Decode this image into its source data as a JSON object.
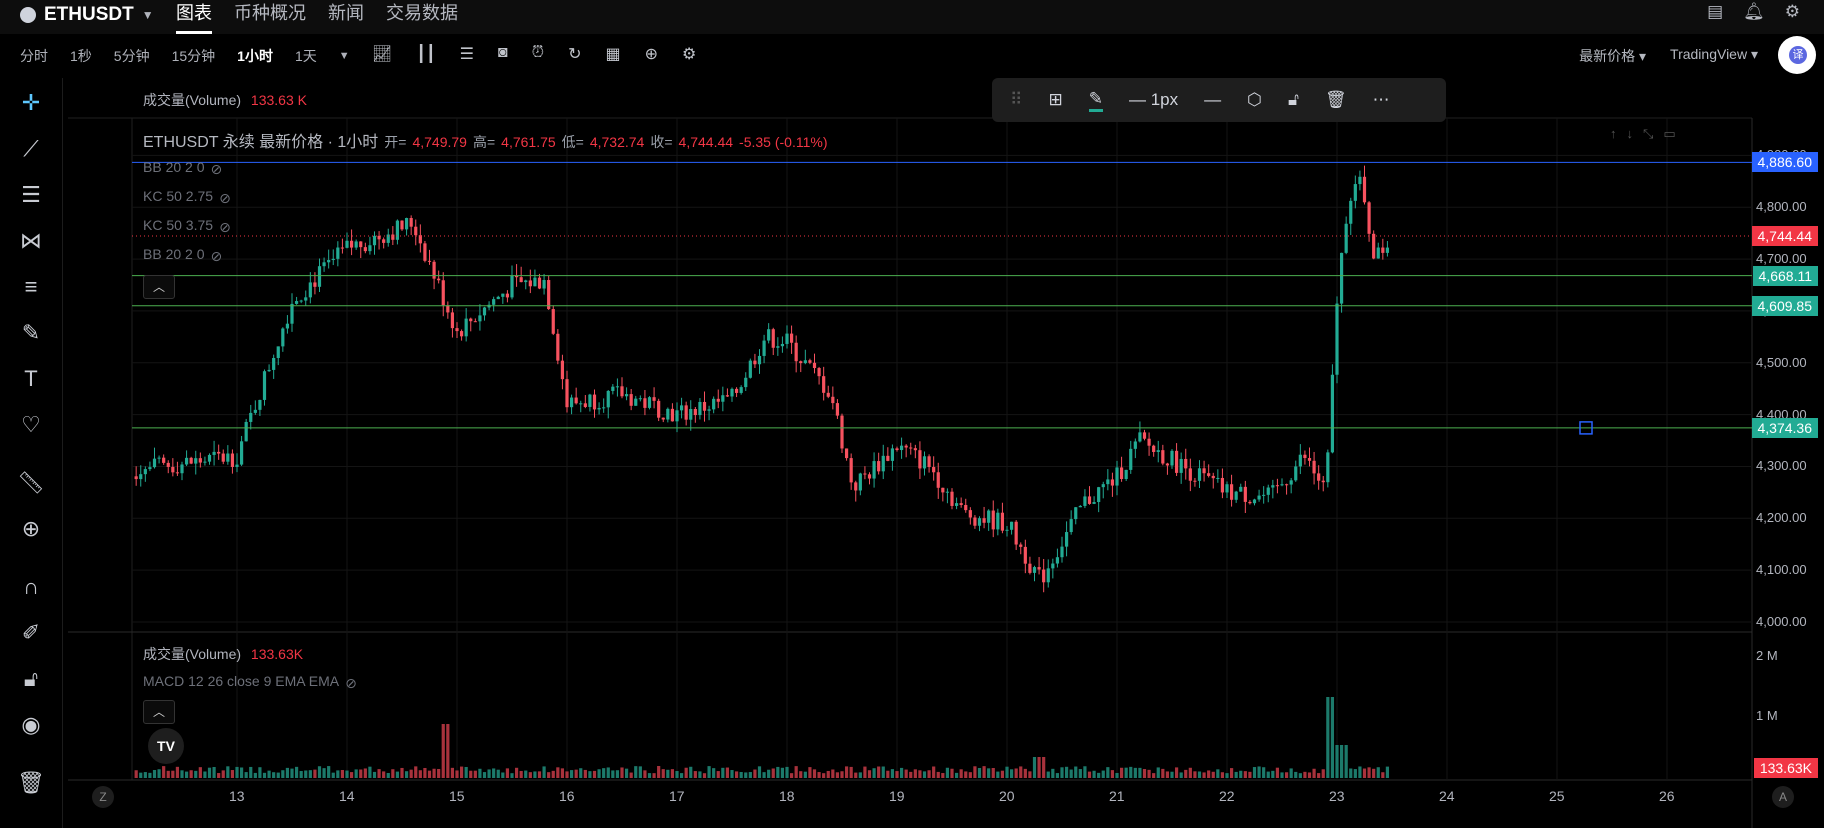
{
  "header": {
    "symbol": "ETHUSDT",
    "tabs": [
      {
        "label": "图表",
        "active": true
      },
      {
        "label": "币种概况",
        "active": false
      },
      {
        "label": "新闻",
        "active": false
      },
      {
        "label": "交易数据",
        "active": false
      }
    ]
  },
  "toolbar": {
    "intervals": [
      "分时",
      "1秒",
      "5分钟",
      "15分钟",
      "1小时",
      "1天"
    ],
    "active_interval": "1小时",
    "price_type": "最新价格",
    "chart_provider": "TradingView",
    "translate_badge": "译"
  },
  "legend": {
    "volume_title": "成交量(Volume)",
    "volume_value": "133.63 K",
    "title": "ETHUSDT 永续 最新价格 · 1小时",
    "open_label": "开=",
    "open": "4,749.79",
    "high_label": "高=",
    "high": "4,761.75",
    "low_label": "低=",
    "low": "4,732.74",
    "close_label": "收=",
    "close": "4,744.44",
    "change": "-5.35 (-0.11%)",
    "indicators": [
      "BB 20 2 0",
      "KC 50 2.75",
      "KC 50 3.75",
      "BB 20 2 0"
    ]
  },
  "drawing_toolbar": {
    "width_label": "1px"
  },
  "price_axis": {
    "ticks": [
      "4,900.00",
      "4,800.00",
      "4,700.00",
      "4,600.00",
      "4,500.00",
      "4,400.00",
      "4,300.00",
      "4,200.00",
      "4,100.00",
      "4,000.00"
    ],
    "boxes": [
      {
        "value": "4,886.60",
        "color": "#2962ff"
      },
      {
        "value": "4,744.44",
        "color": "#f23645"
      },
      {
        "value": "4,668.11",
        "color": "#22ab94"
      },
      {
        "value": "4,609.85",
        "color": "#22ab94"
      },
      {
        "value": "4,374.36",
        "color": "#22ab94"
      }
    ]
  },
  "volume_pane": {
    "title": "成交量(Volume)",
    "value": "133.63K",
    "macd": "MACD 12 26 close 9 EMA EMA",
    "ticks": [
      "2 M",
      "1 M"
    ],
    "last_box": "133.63K"
  },
  "time_axis": {
    "dates": [
      "13",
      "14",
      "15",
      "16",
      "17",
      "18",
      "19",
      "20",
      "21",
      "22",
      "23",
      "24",
      "25",
      "26"
    ],
    "left_button": "Z",
    "right_button": "A"
  },
  "chart_data": {
    "type": "candlestick",
    "interval": "1h",
    "ylim": [
      4000,
      4920
    ],
    "horizontal_lines": [
      4886.6,
      4668.11,
      4609.85,
      4374.36
    ],
    "last_price": 4744.44,
    "approx_close_path": [
      {
        "x": "12",
        "y": 4290
      },
      {
        "x": "13",
        "y": 4320
      },
      {
        "x": "13.5",
        "y": 4620
      },
      {
        "x": "14",
        "y": 4720
      },
      {
        "x": "14.6",
        "y": 4770
      },
      {
        "x": "15",
        "y": 4560
      },
      {
        "x": "15.5",
        "y": 4650
      },
      {
        "x": "15.8",
        "y": 4660
      },
      {
        "x": "16",
        "y": 4420
      },
      {
        "x": "16.5",
        "y": 4440
      },
      {
        "x": "17",
        "y": 4400
      },
      {
        "x": "17.5",
        "y": 4430
      },
      {
        "x": "17.8",
        "y": 4550
      },
      {
        "x": "18",
        "y": 4540
      },
      {
        "x": "18.4",
        "y": 4440
      },
      {
        "x": "18.6",
        "y": 4260
      },
      {
        "x": "19",
        "y": 4340
      },
      {
        "x": "19.3",
        "y": 4300
      },
      {
        "x": "19.6",
        "y": 4210
      },
      {
        "x": "20",
        "y": 4190
      },
      {
        "x": "20.3",
        "y": 4080
      },
      {
        "x": "20.7",
        "y": 4230
      },
      {
        "x": "21",
        "y": 4280
      },
      {
        "x": "21.2",
        "y": 4350
      },
      {
        "x": "21.6",
        "y": 4300
      },
      {
        "x": "22",
        "y": 4250
      },
      {
        "x": "22.4",
        "y": 4240
      },
      {
        "x": "22.7",
        "y": 4320
      },
      {
        "x": "22.9",
        "y": 4250
      },
      {
        "x": "23",
        "y": 4620
      },
      {
        "x": "23.1",
        "y": 4820
      },
      {
        "x": "23.2",
        "y": 4850
      },
      {
        "x": "23.35",
        "y": 4700
      },
      {
        "x": "23.5",
        "y": 4744
      }
    ]
  }
}
